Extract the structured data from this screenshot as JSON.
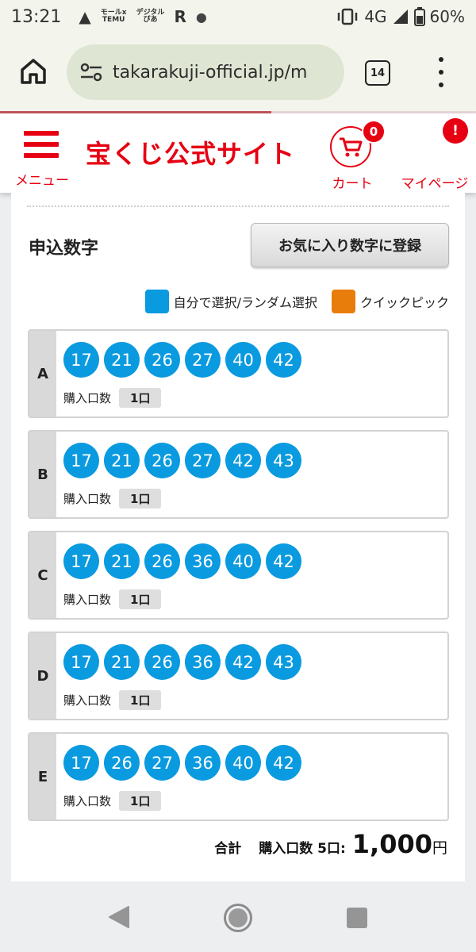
{
  "status_bar": {
    "time": "13:21",
    "temu_top": "モールx",
    "temu_bottom": "TEMU",
    "pia_top": "デジタル",
    "pia_bottom": "ぴあ",
    "r_icon": "R",
    "network": "4G",
    "battery": "60%"
  },
  "browser": {
    "url": "takarakuji-official.jp/m",
    "tab_count": "14"
  },
  "header": {
    "menu_label": "メニュー",
    "logo_text": "宝くじ公式サイト",
    "cart_label": "カート",
    "cart_count": "0",
    "mypage_label": "マイページ",
    "mypage_badge": "!"
  },
  "section": {
    "title": "申込数字",
    "favorite_button": "お気に入り数字に登録"
  },
  "legend": {
    "self_select": {
      "label": "自分で選択/ランダム選択",
      "color": "#0a9ae0"
    },
    "quick_pick": {
      "label": "クイックピック",
      "color": "#e97d0c"
    }
  },
  "lines": [
    {
      "label": "A",
      "numbers": [
        "17",
        "21",
        "26",
        "27",
        "40",
        "42"
      ],
      "qty_label": "購入口数",
      "qty": "1口"
    },
    {
      "label": "B",
      "numbers": [
        "17",
        "21",
        "26",
        "27",
        "42",
        "43"
      ],
      "qty_label": "購入口数",
      "qty": "1口"
    },
    {
      "label": "C",
      "numbers": [
        "17",
        "21",
        "26",
        "36",
        "40",
        "42"
      ],
      "qty_label": "購入口数",
      "qty": "1口"
    },
    {
      "label": "D",
      "numbers": [
        "17",
        "21",
        "26",
        "36",
        "42",
        "43"
      ],
      "qty_label": "購入口数",
      "qty": "1口"
    },
    {
      "label": "E",
      "numbers": [
        "17",
        "26",
        "27",
        "36",
        "40",
        "42"
      ],
      "qty_label": "購入口数",
      "qty": "1口"
    }
  ],
  "total": {
    "label": "合計",
    "count_text": "購入口数 5口:",
    "amount": "1,000",
    "unit": "円"
  },
  "colors": {
    "brand_red": "#e60012",
    "ball_blue": "#0a9ae0"
  }
}
